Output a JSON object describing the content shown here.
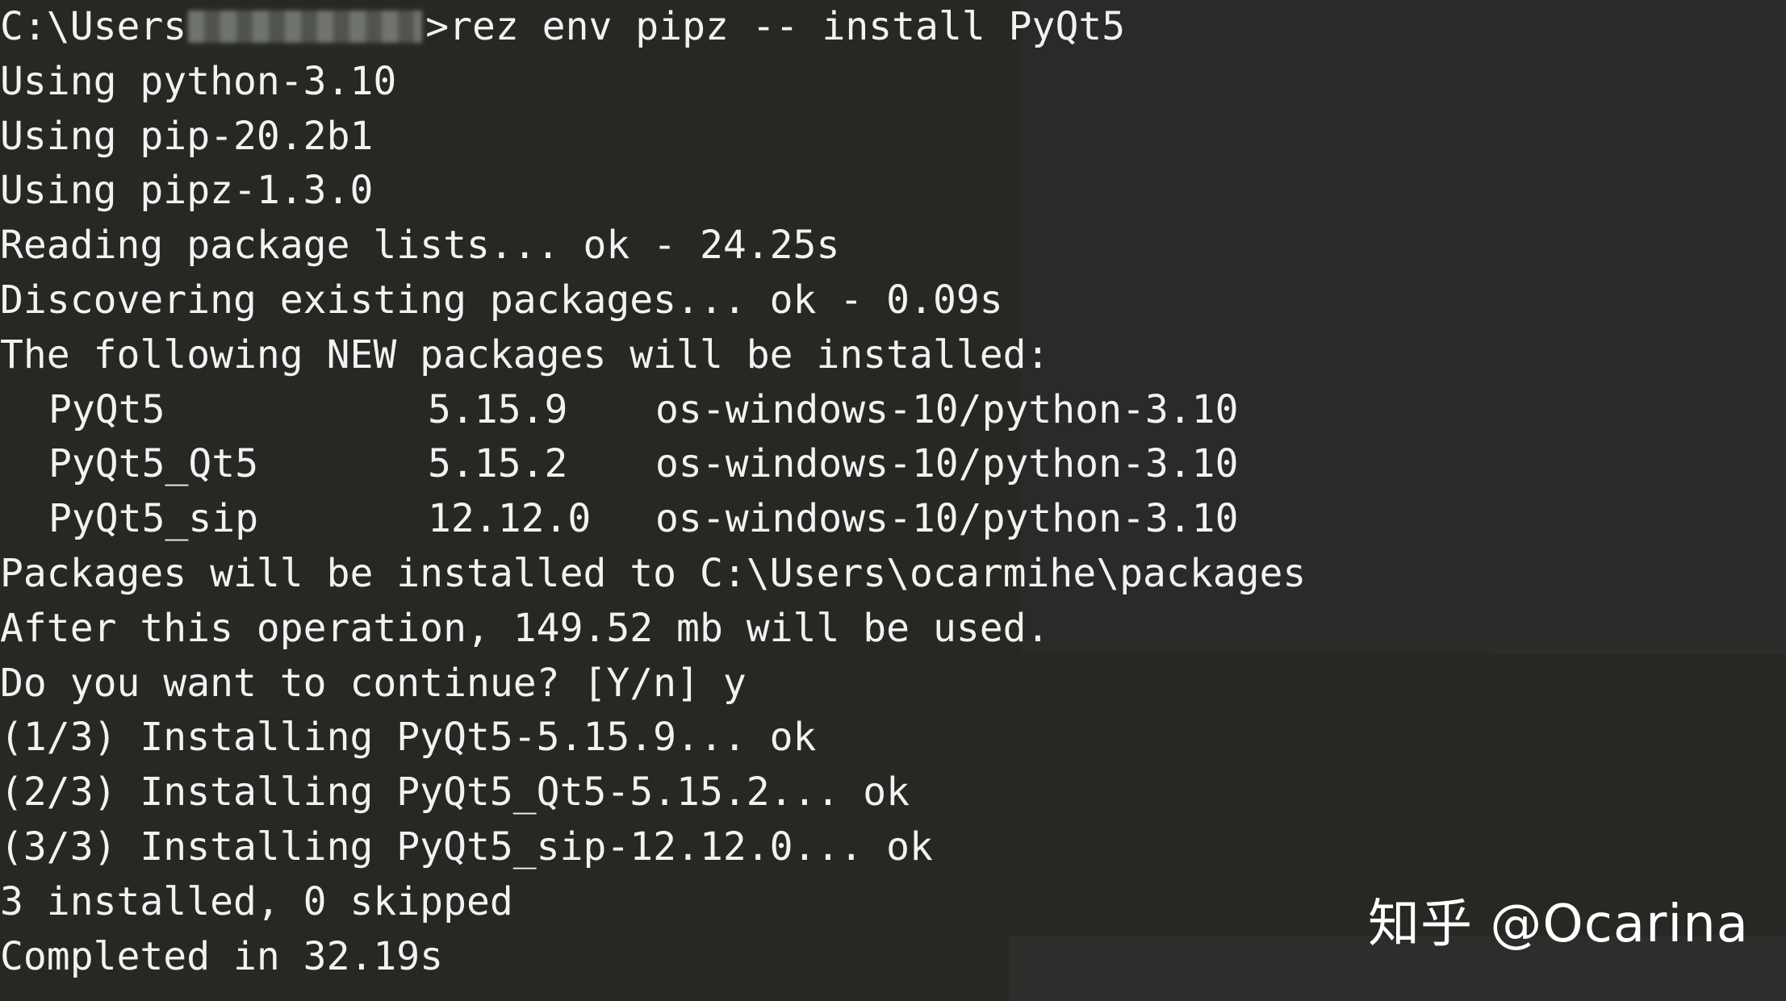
{
  "terminal": {
    "prompt_prefix": "C:\\Users",
    "prompt_command": ">rez env pipz -- install PyQt5",
    "output_before_table": [
      "Using python-3.10",
      "Using pip-20.2b1",
      "Using pipz-1.3.0",
      "Reading package lists... ok - 24.25s",
      "Discovering existing packages... ok - 0.09s",
      "The following NEW packages will be installed:"
    ],
    "packages": [
      {
        "name": "PyQt5",
        "version": "5.15.9",
        "variant": "os-windows-10/python-3.10"
      },
      {
        "name": "PyQt5_Qt5",
        "version": "5.15.2",
        "variant": "os-windows-10/python-3.10"
      },
      {
        "name": "PyQt5_sip",
        "version": "12.12.0",
        "variant": "os-windows-10/python-3.10"
      }
    ],
    "output_after_table": [
      "Packages will be installed to C:\\Users\\ocarmihe\\packages",
      "After this operation, 149.52 mb will be used.",
      "Do you want to continue? [Y/n] y",
      "(1/3) Installing PyQt5-5.15.9... ok",
      "(2/3) Installing PyQt5_Qt5-5.15.2... ok",
      "(3/3) Installing PyQt5_sip-12.12.0... ok",
      "3 installed, 0 skipped",
      "Completed in 32.19s"
    ]
  },
  "watermark": "知乎 @Ocarina",
  "colors": {
    "background": "#262824",
    "text": "#f2f2f2"
  }
}
